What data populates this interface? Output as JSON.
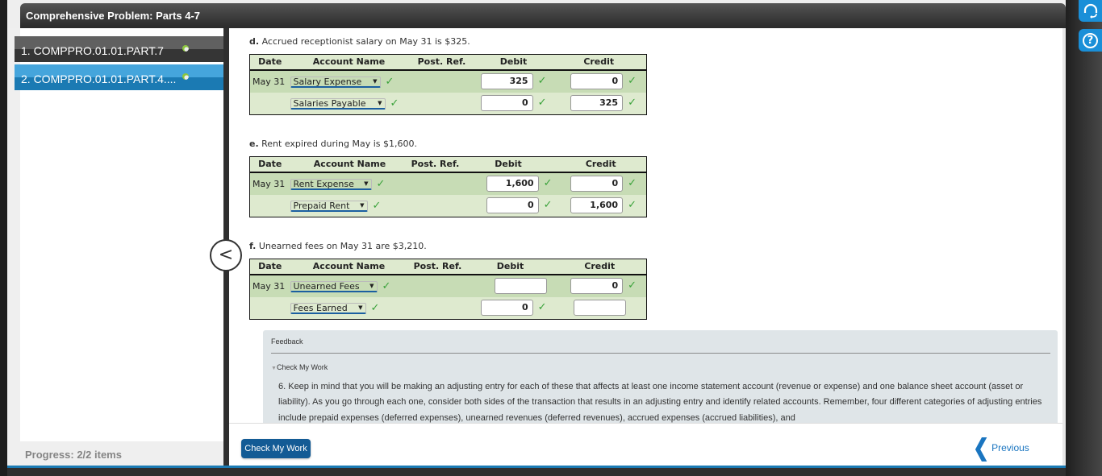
{
  "window": {
    "title": "Comprehensive Problem: Parts 4-7"
  },
  "sidebar": {
    "items": [
      {
        "label": "1. COMPPRO.01.01.PART.7",
        "status": "complete",
        "active": false
      },
      {
        "label": "2. COMPPRO.01.01.PART.4....",
        "status": "complete",
        "active": true
      }
    ],
    "progress_label": "Progress:",
    "progress_value": "2/2 items",
    "collapse_icon": "<"
  },
  "journal": {
    "columns": [
      "Date",
      "Account Name",
      "Post. Ref.",
      "Debit",
      "Credit"
    ],
    "problems": [
      {
        "letter": "d.",
        "description": "Accrued receptionist salary on May 31 is $325.",
        "rows": [
          {
            "date": "May 31",
            "account": "Salary Expense",
            "account_ok": true,
            "post_ref": "",
            "debit": "325",
            "debit_ok": true,
            "credit": "0",
            "credit_ok": true
          },
          {
            "date": "",
            "account": "Salaries Payable",
            "account_ok": true,
            "post_ref": "",
            "debit": "0",
            "debit_ok": true,
            "credit": "325",
            "credit_ok": true
          }
        ]
      },
      {
        "letter": "e.",
        "description": "Rent expired during May is $1,600.",
        "rows": [
          {
            "date": "May 31",
            "account": "Rent Expense",
            "account_ok": true,
            "post_ref": "",
            "debit": "1,600",
            "debit_ok": true,
            "credit": "0",
            "credit_ok": true
          },
          {
            "date": "",
            "account": "Prepaid Rent",
            "account_ok": true,
            "post_ref": "",
            "debit": "0",
            "debit_ok": true,
            "credit": "1,600",
            "credit_ok": true
          }
        ]
      },
      {
        "letter": "f.",
        "description": "Unearned fees on May 31 are $3,210.",
        "rows": [
          {
            "date": "May 31",
            "account": "Unearned Fees",
            "account_ok": true,
            "post_ref": "",
            "debit": "",
            "debit_ok": false,
            "credit": "0",
            "credit_ok": true
          },
          {
            "date": "",
            "account": "Fees Earned",
            "account_ok": true,
            "post_ref": "",
            "debit": "0",
            "debit_ok": true,
            "credit": "",
            "credit_ok": false
          }
        ]
      }
    ]
  },
  "feedback": {
    "title": "Feedback",
    "toggle_label": "Check My Work",
    "text": "6. Keep in mind that you will be making an adjusting entry for each of these that affects at least one income statement account (revenue or expense) and one balance sheet account (asset or liability). As you go through each one, consider both sides of the transaction that results in an adjusting entry and identify related accounts. Remember, four different categories of adjusting entries include prepaid expenses (deferred expenses), unearned revenues (deferred revenues), accrued expenses (accrued liabilities), and"
  },
  "footer": {
    "check_my_work_label": "Check My Work",
    "previous_label": "Previous"
  },
  "icons": {
    "check": "✓",
    "dropdown_arrow": "▼",
    "toggle_arrow": "▼",
    "previous_chevron": "❮",
    "help": "?"
  },
  "colors": {
    "accent_blue": "#1b7ab3",
    "button_blue": "#135b95",
    "check_green": "#3aa23a",
    "row_green_dark": "#c7dcb5",
    "row_green_light": "#deeacf"
  }
}
